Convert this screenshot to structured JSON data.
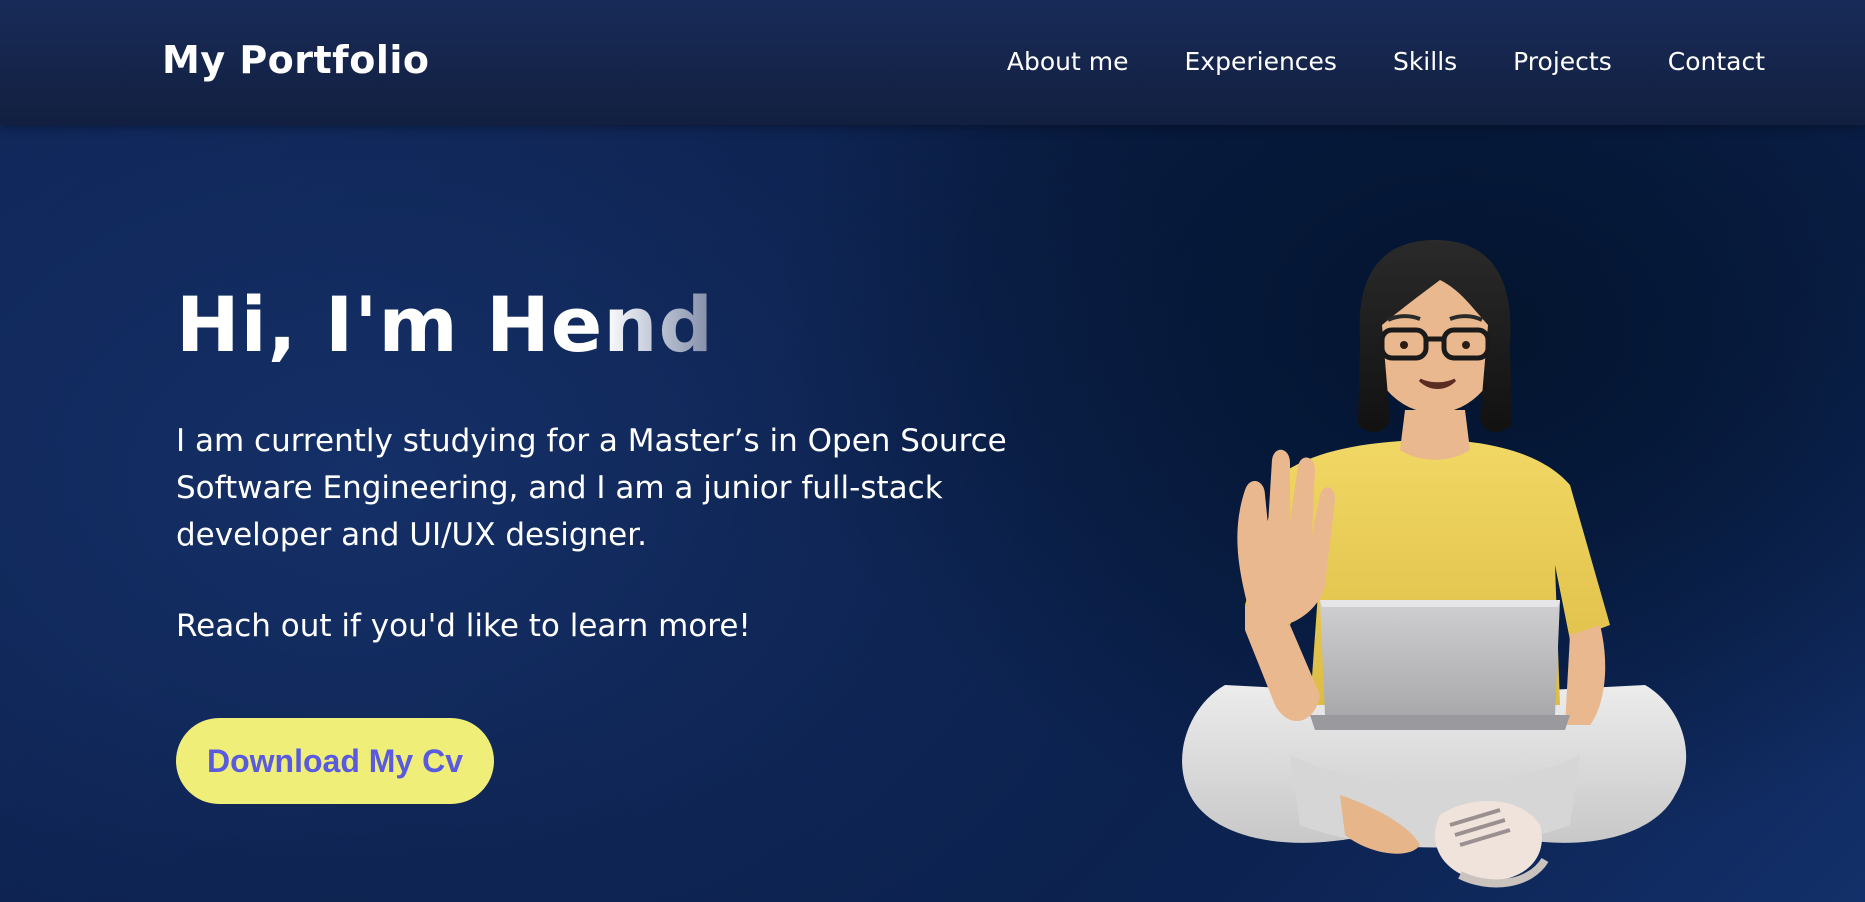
{
  "navbar": {
    "logo": "My Portfolio",
    "links": [
      "About me",
      "Experiences",
      "Skills",
      "Projects",
      "Contact"
    ]
  },
  "hero": {
    "greeting_main": "Hi, I'm He",
    "greeting_fade": "nd",
    "intro": "I am currently studying for a Master’s in Open Source Software Engineering, and I am a junior full-stack developer and UI/UX designer.",
    "cta_text": "Reach out if you'd like to learn more!",
    "download_label": "Download My Cv"
  },
  "illustration": {
    "icon": "girl-with-laptop-waving-illustration"
  },
  "colors": {
    "background": "#0e2455",
    "navbar": "#182b58",
    "button_bg": "#eeee78",
    "button_text": "#5a5ae0",
    "shirt": "#eccf5a",
    "pants": "#dcdcdc"
  }
}
